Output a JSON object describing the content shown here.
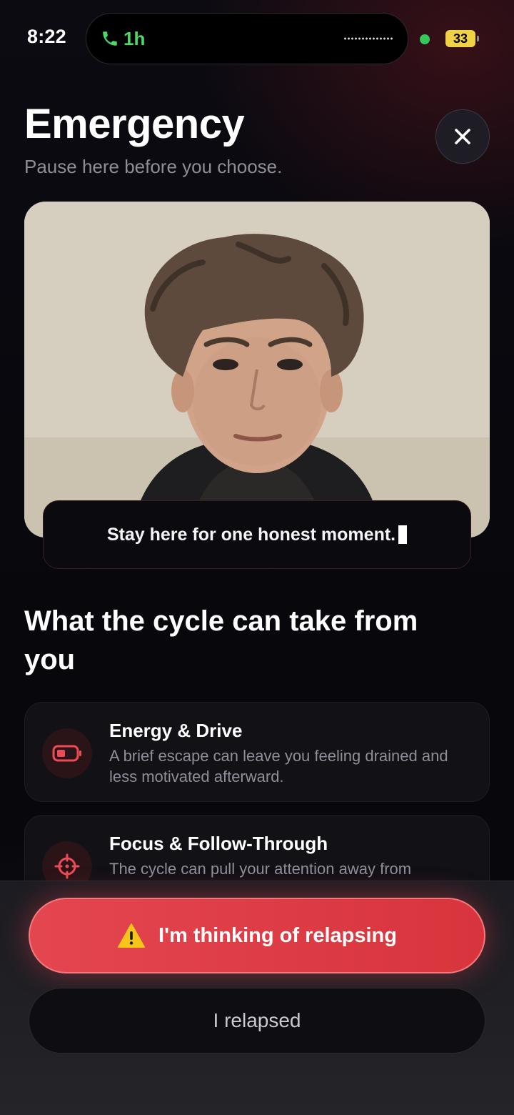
{
  "status_bar": {
    "time": "8:22",
    "call_duration": "1h",
    "battery": "33"
  },
  "header": {
    "title": "Emergency",
    "subtitle": "Pause here before you choose."
  },
  "photo": {
    "caption": "Stay here for one honest moment."
  },
  "section": {
    "title": "What the cycle can take from you",
    "cards": [
      {
        "title": "Energy & Drive",
        "description": "A brief escape can leave you feeling drained and less motivated afterward.",
        "icon": "battery-low-icon"
      },
      {
        "title": "Focus & Follow-Through",
        "description": "The cycle can pull your attention away from",
        "icon": "crosshair-icon"
      }
    ]
  },
  "actions": {
    "primary_label": "I'm thinking of relapsing",
    "primary_icon": "warning-icon",
    "secondary_label": "I relapsed"
  },
  "colors": {
    "accent_red": "#e4464f",
    "call_green": "#4cd964",
    "battery_yellow": "#f2d245"
  }
}
